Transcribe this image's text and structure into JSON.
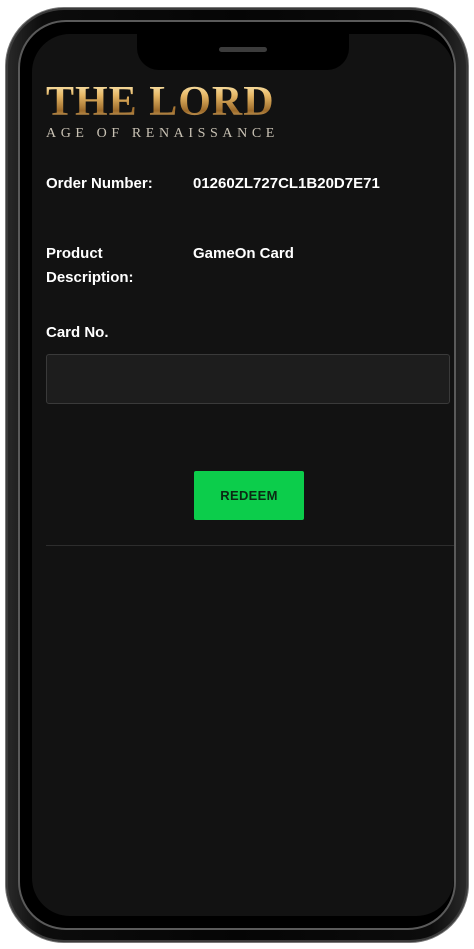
{
  "logo": {
    "title": "THE LORD",
    "subtitle": "AGE OF RENAISSANCE"
  },
  "order": {
    "label": "Order Number:",
    "value": "01260ZL727CL1B20D7E71"
  },
  "product": {
    "label": "Product Description:",
    "value": "GameOn Card"
  },
  "card": {
    "label": "Card No.",
    "input_value": ""
  },
  "redeem": {
    "label": "REDEEM"
  },
  "colors": {
    "screen_bg": "#121212",
    "button": "#0ccd4b",
    "logo_gold": "#d9b06a"
  }
}
